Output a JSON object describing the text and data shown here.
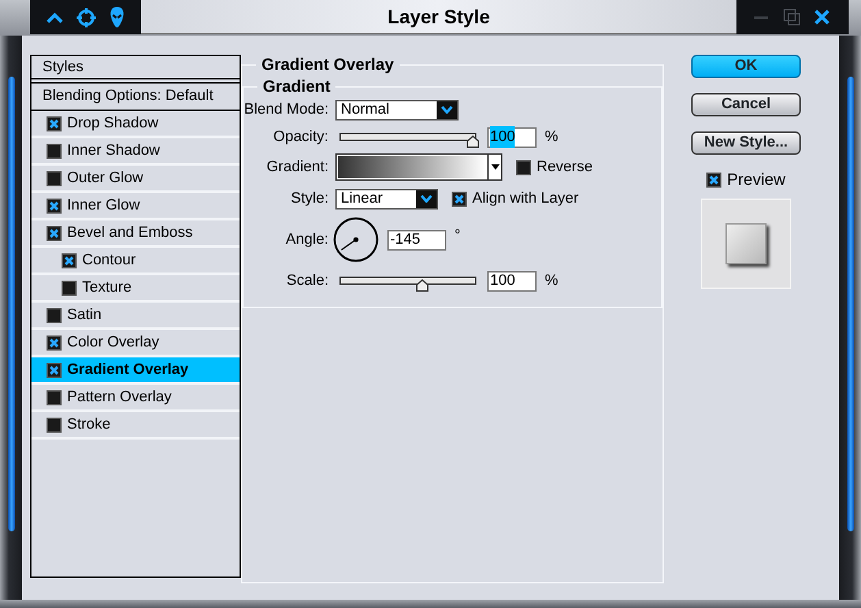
{
  "window": {
    "title": "Layer Style"
  },
  "styles_list": {
    "header": "Styles",
    "blending_options": "Blending Options: Default",
    "items": [
      {
        "label": "Drop Shadow",
        "checked": true,
        "selected": false
      },
      {
        "label": "Inner Shadow",
        "checked": false,
        "selected": false
      },
      {
        "label": "Outer Glow",
        "checked": false,
        "selected": false
      },
      {
        "label": "Inner Glow",
        "checked": true,
        "selected": false
      },
      {
        "label": "Bevel and Emboss",
        "checked": true,
        "selected": false,
        "children": [
          {
            "label": "Contour",
            "checked": true,
            "selected": false
          },
          {
            "label": "Texture",
            "checked": false,
            "selected": false
          }
        ]
      },
      {
        "label": "Satin",
        "checked": false,
        "selected": false
      },
      {
        "label": "Color Overlay",
        "checked": true,
        "selected": false
      },
      {
        "label": "Gradient Overlay",
        "checked": true,
        "selected": true
      },
      {
        "label": "Pattern Overlay",
        "checked": false,
        "selected": false
      },
      {
        "label": "Stroke",
        "checked": false,
        "selected": false
      }
    ]
  },
  "gradient_overlay": {
    "title": "Gradient Overlay",
    "group_title": "Gradient",
    "blend_mode": {
      "label": "Blend Mode:",
      "value": "Normal"
    },
    "opacity": {
      "label": "Opacity:",
      "level": 0.98,
      "value": "100",
      "value_selected": true,
      "unit": "%"
    },
    "gradient": {
      "label": "Gradient:"
    },
    "reverse": {
      "label": "Reverse",
      "checked": false
    },
    "style": {
      "label": "Style:",
      "value": "Linear"
    },
    "align_with_layer": {
      "label": "Align with Layer",
      "checked": true
    },
    "angle": {
      "label": "Angle:",
      "value": "-145",
      "unit": "°"
    },
    "scale": {
      "label": "Scale:",
      "level": 0.6,
      "value": "100",
      "unit": "%"
    }
  },
  "buttons": [
    {
      "label": "OK",
      "kind": "primary"
    },
    {
      "label": "Cancel",
      "kind": "default"
    },
    {
      "label": "New Style...",
      "kind": "default"
    }
  ],
  "preview": {
    "label": "Preview",
    "checked": true
  }
}
